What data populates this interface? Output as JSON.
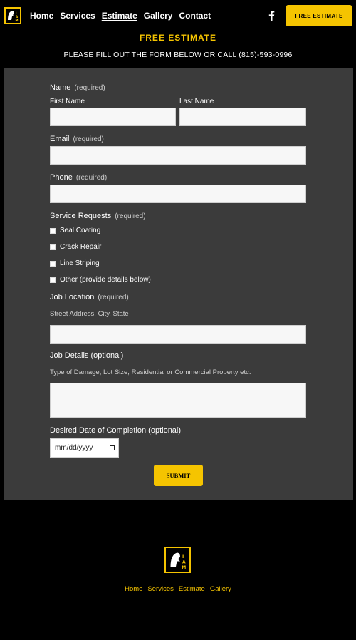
{
  "header": {
    "logo_text": "I·A·M",
    "nav": [
      "Home",
      "Services",
      "Estimate",
      "Gallery",
      "Contact"
    ],
    "active_nav": "Estimate",
    "cta_label": "FREE ESTIMATE",
    "social_icon": "facebook-icon"
  },
  "page": {
    "title": "FREE ESTIMATE",
    "subtitle": "PLEASE FILL OUT THE FORM BELOW OR CALL (815)-593-0996"
  },
  "form": {
    "required_tag": "(required)",
    "name_label": "Name",
    "first_name_label": "First Name",
    "last_name_label": "Last Name",
    "email_label": "Email",
    "phone_label": "Phone",
    "service_label": "Service Requests",
    "services": [
      "Seal Coating",
      "Crack Repair",
      "Line Striping",
      "Other (provide details below)"
    ],
    "location_label": "Job Location",
    "location_hint": "Street Address, City, State",
    "details_label": "Job Details (optional)",
    "details_hint": "Type of Damage, Lot Size, Residential or Commercial Property etc.",
    "date_label": "Desired Date of Completion (optional)",
    "date_placeholder": "mm/dd/yyyy",
    "submit_label": "SUBMIT"
  },
  "footer": {
    "logo_text": "I·A·M",
    "links": [
      "Home",
      "Services",
      "Estimate",
      "Gallery"
    ]
  },
  "colors": {
    "accent": "#f5c400",
    "panel": "#3b3b3b",
    "background": "#000000"
  }
}
